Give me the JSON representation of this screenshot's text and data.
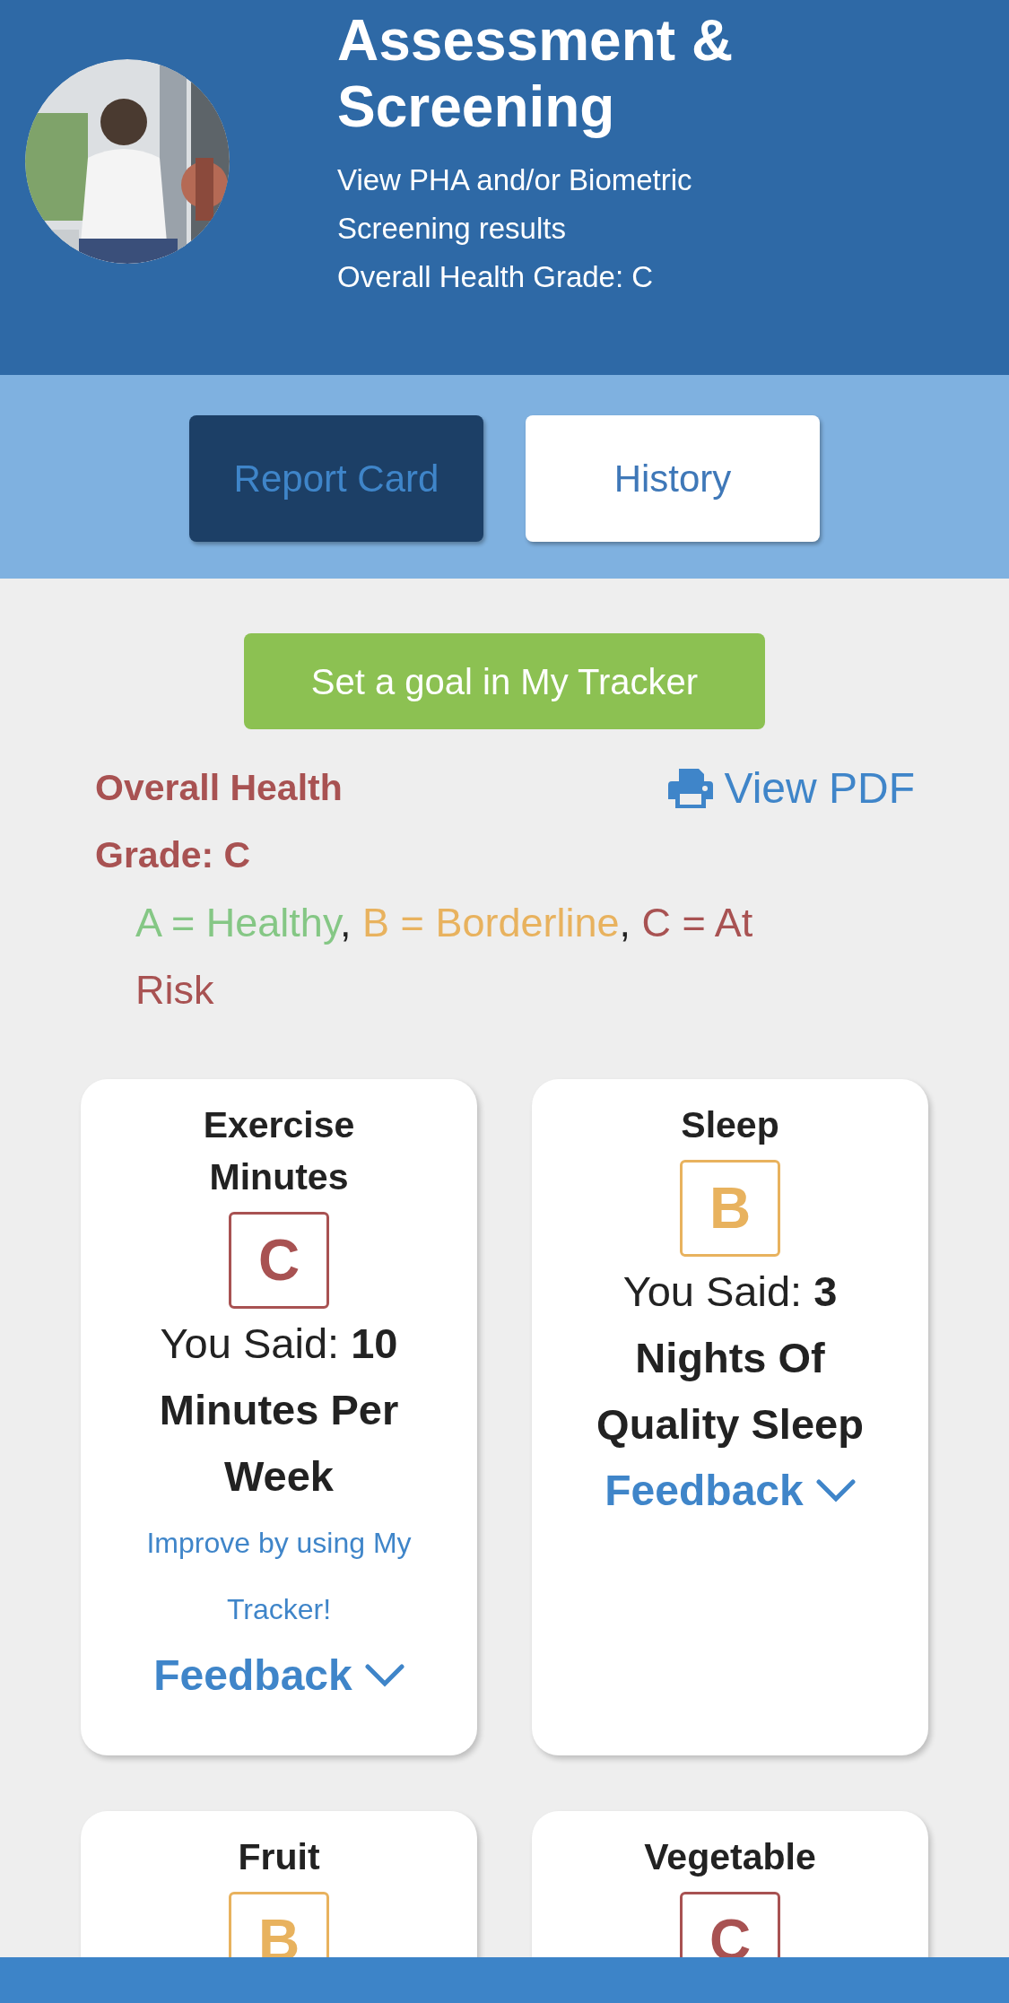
{
  "header": {
    "title": "Assessment & Screening",
    "subtitle_lines": [
      "View PHA and/or Biometric",
      "Screening results",
      "Overall Health Grade: C"
    ]
  },
  "tabs": [
    {
      "label": "Report Card",
      "selected": true
    },
    {
      "label": "History",
      "selected": false
    }
  ],
  "goal_button": "Set a goal in My Tracker",
  "overall_grade": "Overall Health Grade: C",
  "view_pdf": "View PDF",
  "legend": [
    {
      "text": "A = Healthy",
      "color": "#85c785"
    },
    {
      "text": ", ",
      "color": "#222222"
    },
    {
      "text": "B = Borderline",
      "color": "#e8b25e"
    },
    {
      "text": ", ",
      "color": "#222222"
    },
    {
      "text": "C = At Risk",
      "color": "#a85252"
    }
  ],
  "cards": [
    {
      "title": "Exercise Minutes",
      "grade": {
        "letter": "C",
        "color": "#a85252"
      },
      "said": "You Said: **10 Minutes Per Week**",
      "tip": "Improve by using My Tracker!",
      "feedback": "Feedback"
    },
    {
      "title": "Sleep",
      "grade": {
        "letter": "B",
        "color": "#e8b25e"
      },
      "said": "You Said: **3 Nights Of Quality Sleep**",
      "feedback": "Feedback"
    },
    {
      "title": "Fruit",
      "grade": {
        "letter": "B",
        "color": "#e8b25e"
      }
    },
    {
      "title": "Vegetable",
      "grade": {
        "letter": "C",
        "color": "#a85252"
      }
    }
  ]
}
